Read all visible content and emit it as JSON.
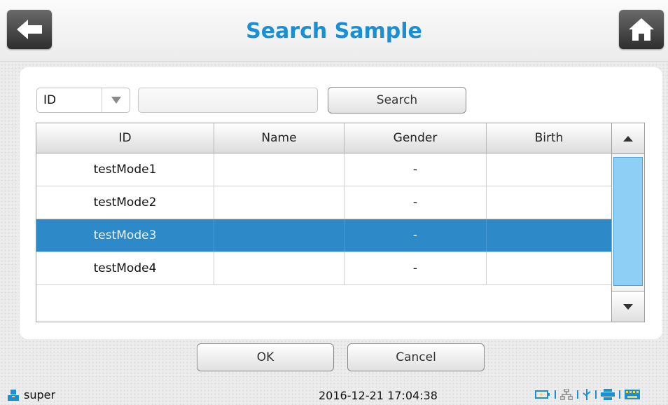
{
  "header": {
    "title": "Search Sample",
    "back_icon": "arrow-left-icon",
    "home_icon": "home-icon"
  },
  "search": {
    "field_select": {
      "value": "ID",
      "icon": "triangle-down-icon"
    },
    "input_value": "",
    "button_label": "Search"
  },
  "table": {
    "columns": [
      "ID",
      "Name",
      "Gender",
      "Birth"
    ],
    "rows": [
      {
        "id": "testMode1",
        "name": "",
        "gender": "-",
        "birth": ""
      },
      {
        "id": "testMode2",
        "name": "",
        "gender": "-",
        "birth": ""
      },
      {
        "id": "testMode3",
        "name": "",
        "gender": "-",
        "birth": ""
      },
      {
        "id": "testMode4",
        "name": "",
        "gender": "-",
        "birth": ""
      }
    ],
    "selected_row_index": 2
  },
  "dialog": {
    "ok_label": "OK",
    "cancel_label": "Cancel"
  },
  "statusbar": {
    "user": "super",
    "datetime": "2016-12-21 17:04:38",
    "icons": [
      "user-icon",
      "battery-icon",
      "network-icon",
      "usb-icon",
      "printer-icon",
      "keyboard-icon"
    ]
  },
  "colors": {
    "accent": "#1a8fd3",
    "selected_row": "#2e89c9",
    "scroll_thumb": "#8dcff5"
  }
}
